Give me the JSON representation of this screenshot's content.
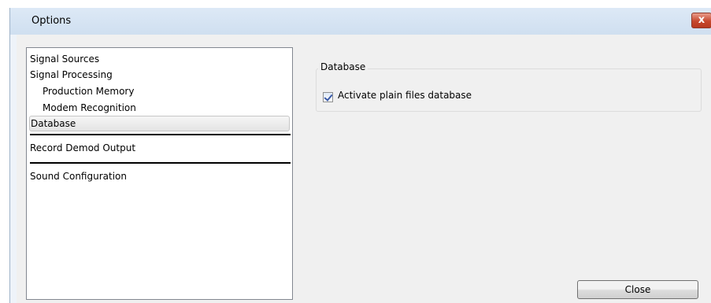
{
  "window": {
    "title": "Options",
    "close_glyph": "x"
  },
  "sidebar": {
    "items": [
      {
        "label": "Signal Sources"
      },
      {
        "label": "Signal Processing"
      },
      {
        "label": "Production Memory"
      },
      {
        "label": "Modem Recognition"
      },
      {
        "label": "Database",
        "selected": true
      },
      {
        "label": "Record Demod Output"
      },
      {
        "label": "Sound Configuration"
      }
    ]
  },
  "database_panel": {
    "group_label": "Database",
    "activate_label": "Activate plain files database",
    "activate_checked": true
  },
  "footer": {
    "close_label": "Close"
  },
  "colors": {
    "titlebar": "#d8e6f4",
    "close_x": "#c6482d",
    "dialog_bg": "#f0f0f0",
    "checkmark": "#3a5aa8"
  }
}
